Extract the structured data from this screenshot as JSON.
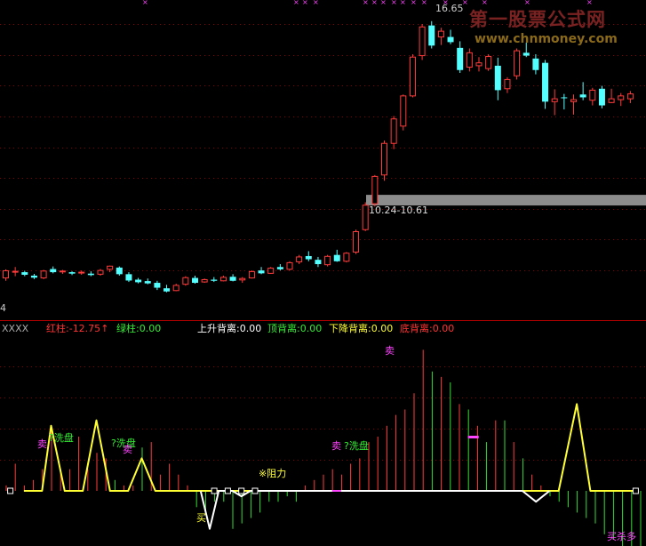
{
  "watermark": {
    "line1": "第一股票公式网",
    "line2": "www.chnmoney.com"
  },
  "colors": {
    "up": "#ff3b3b",
    "down": "#54ffff",
    "grid": "#8a0000",
    "yellow": "#ffff33",
    "magenta": "#ff44ff",
    "green": "#33dd33",
    "white": "#ffffff",
    "band": "#8c8c8c"
  },
  "main_panel": {
    "high_label": "16.65",
    "support_label": "10.24-10.61",
    "left_axis_label": "4"
  },
  "indicator_header": {
    "name": "XXXX",
    "red_label": "红柱:",
    "red_value": "-12.75",
    "arrow": "↑",
    "green_label": "绿柱:",
    "green_value": "0.00",
    "rise_label": "上升背离:",
    "rise_value": "0.00",
    "top_label": "顶背离:",
    "top_value": "0.00",
    "fall_label": "下降背离:",
    "fall_value": "0.00",
    "bottom_label": "底背离:",
    "bottom_value": "0.00"
  },
  "annotations": {
    "sell1": "卖",
    "wash1": "?洗盘",
    "wash2": "?洗盘",
    "sell2": "卖",
    "buy1": "买",
    "resist": "※阻力",
    "sell3": "卖",
    "wash3": "?洗盘",
    "sell4": "卖",
    "buy_end": "买杀多"
  },
  "chart_data": [
    {
      "type": "candlestick",
      "title": "",
      "xlabel": "",
      "ylabel": "",
      "ylim": [
        6.5,
        17.2
      ],
      "grid": true,
      "annotations": [
        "16.65",
        "10.24-10.61"
      ],
      "support_band": [
        10.24,
        10.61
      ],
      "ohlc": [
        [
          7.72,
          8.02,
          7.62,
          7.97
        ],
        [
          7.95,
          8.1,
          7.78,
          7.95
        ],
        [
          7.92,
          7.97,
          7.78,
          7.83
        ],
        [
          7.8,
          7.86,
          7.68,
          7.73
        ],
        [
          7.72,
          8.0,
          7.68,
          7.96
        ],
        [
          8.03,
          8.12,
          7.88,
          7.92
        ],
        [
          7.95,
          8.0,
          7.86,
          7.96
        ],
        [
          7.92,
          7.95,
          7.82,
          7.87
        ],
        [
          7.9,
          7.98,
          7.83,
          7.92
        ],
        [
          7.87,
          7.95,
          7.78,
          7.82
        ],
        [
          7.85,
          8.03,
          7.8,
          7.98
        ],
        [
          8.02,
          8.15,
          7.92,
          8.13
        ],
        [
          8.08,
          8.12,
          7.8,
          7.85
        ],
        [
          7.85,
          7.92,
          7.58,
          7.63
        ],
        [
          7.66,
          7.72,
          7.53,
          7.57
        ],
        [
          7.61,
          7.7,
          7.5,
          7.53
        ],
        [
          7.55,
          7.62,
          7.3,
          7.38
        ],
        [
          7.36,
          7.48,
          7.22,
          7.25
        ],
        [
          7.28,
          7.52,
          7.26,
          7.46
        ],
        [
          7.5,
          7.78,
          7.45,
          7.73
        ],
        [
          7.72,
          7.8,
          7.52,
          7.55
        ],
        [
          7.58,
          7.7,
          7.55,
          7.66
        ],
        [
          7.66,
          7.75,
          7.58,
          7.62
        ],
        [
          7.62,
          7.8,
          7.6,
          7.74
        ],
        [
          7.76,
          7.85,
          7.6,
          7.62
        ],
        [
          7.65,
          7.75,
          7.55,
          7.7
        ],
        [
          7.72,
          7.98,
          7.7,
          7.94
        ],
        [
          7.98,
          8.1,
          7.85,
          7.88
        ],
        [
          7.88,
          8.1,
          7.86,
          8.06
        ],
        [
          8.1,
          8.2,
          7.98,
          8.02
        ],
        [
          8.02,
          8.3,
          7.98,
          8.25
        ],
        [
          8.28,
          8.52,
          8.2,
          8.45
        ],
        [
          8.48,
          8.65,
          8.3,
          8.37
        ],
        [
          8.35,
          8.45,
          8.1,
          8.2
        ],
        [
          8.18,
          8.52,
          8.12,
          8.47
        ],
        [
          8.52,
          8.7,
          8.28,
          8.3
        ],
        [
          8.3,
          8.62,
          8.26,
          8.58
        ],
        [
          8.62,
          9.4,
          8.55,
          9.33
        ],
        [
          9.4,
          10.35,
          9.35,
          10.25
        ],
        [
          10.3,
          11.3,
          10.2,
          11.25
        ],
        [
          11.3,
          12.5,
          11.1,
          12.4
        ],
        [
          12.4,
          13.35,
          12.2,
          13.25
        ],
        [
          13.0,
          14.1,
          12.85,
          14.05
        ],
        [
          14.05,
          15.5,
          14.0,
          15.4
        ],
        [
          15.45,
          16.55,
          15.3,
          16.45
        ],
        [
          16.5,
          16.65,
          15.7,
          15.8
        ],
        [
          16.1,
          16.42,
          15.82,
          16.3
        ],
        [
          16.1,
          16.35,
          15.85,
          15.92
        ],
        [
          15.72,
          15.95,
          14.85,
          14.95
        ],
        [
          15.05,
          15.7,
          14.9,
          15.55
        ],
        [
          15.1,
          15.4,
          14.9,
          15.2
        ],
        [
          15.0,
          15.5,
          14.92,
          15.42
        ],
        [
          15.1,
          15.38,
          13.9,
          14.25
        ],
        [
          14.3,
          14.7,
          14.15,
          14.62
        ],
        [
          14.75,
          15.7,
          14.62,
          15.62
        ],
        [
          15.55,
          15.9,
          15.4,
          15.45
        ],
        [
          15.35,
          15.5,
          14.8,
          14.95
        ],
        [
          15.2,
          15.3,
          13.6,
          13.85
        ],
        [
          13.85,
          14.28,
          13.38,
          13.95
        ],
        [
          14.0,
          14.12,
          13.58,
          13.98
        ],
        [
          13.85,
          14.1,
          13.4,
          13.92
        ],
        [
          14.1,
          14.53,
          13.9,
          14.0
        ],
        [
          13.9,
          14.33,
          13.72,
          14.25
        ],
        [
          14.3,
          14.4,
          13.62,
          13.72
        ],
        [
          13.82,
          14.3,
          13.8,
          13.95
        ],
        [
          13.92,
          14.15,
          13.7,
          14.05
        ],
        [
          13.95,
          14.22,
          13.8,
          14.12
        ]
      ]
    },
    {
      "type": "bar",
      "title": "XXXX",
      "xlabel": "",
      "ylabel": "",
      "ylim": [
        -12,
        30
      ],
      "grid": true,
      "bar_values": [
        1,
        5,
        1,
        2,
        4,
        11,
        4,
        4,
        10,
        4,
        7,
        6,
        2,
        1,
        1,
        8,
        9,
        3,
        5,
        3,
        1,
        -3,
        -4,
        -2,
        -2,
        -7,
        -6,
        -5,
        -4,
        -2,
        -2,
        -1,
        -2,
        1,
        2,
        3,
        4,
        3,
        5,
        6,
        9,
        10,
        12,
        14,
        15,
        18,
        26,
        22,
        21,
        20,
        16,
        15,
        12,
        9,
        13,
        13,
        9,
        6,
        3,
        1,
        -1,
        -2,
        -3,
        -4,
        -5,
        -6,
        -8,
        -9,
        -11,
        -12,
        -12,
        -11,
        -13,
        -12,
        -7
      ],
      "series": [
        {
          "name": "",
          "type": "line",
          "color": "yellow",
          "points": [
            [
              4,
              0
            ],
            [
              8,
              0
            ],
            [
              10,
              12
            ],
            [
              13,
              0
            ],
            [
              17,
              0
            ],
            [
              20,
              13
            ],
            [
              23,
              0
            ],
            [
              27,
              0
            ],
            [
              30,
              6
            ],
            [
              33,
              0
            ],
            [
              41,
              0
            ],
            [
              53,
              0
            ],
            [
              57,
              0
            ],
            [
              66,
              0
            ],
            [
              70,
              0
            ],
            [
              87,
              0
            ],
            [
              94,
              0
            ],
            [
              101,
              0
            ],
            [
              107,
              0
            ],
            [
              112,
              0
            ],
            [
              118,
              0
            ],
            [
              122,
              0
            ],
            [
              126,
              16
            ],
            [
              129,
              0
            ],
            [
              139,
              0
            ]
          ]
        },
        {
          "name": "",
          "type": "line",
          "color": "white",
          "points": [
            [
              43,
              0
            ],
            [
              45,
              -7
            ],
            [
              47,
              0
            ],
            [
              50,
              0
            ],
            [
              52,
              -1
            ],
            [
              54,
              0
            ],
            [
              114,
              0
            ],
            [
              117,
              -2
            ],
            [
              120,
              0
            ]
          ]
        }
      ],
      "markers": {
        "white_squares": [
          1,
          46,
          49,
          52,
          55,
          139
        ]
      }
    }
  ]
}
